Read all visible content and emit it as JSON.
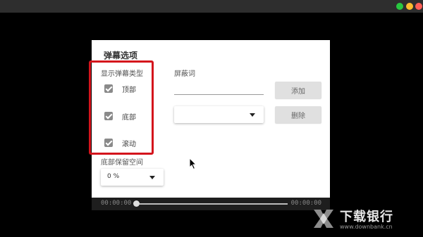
{
  "window": {
    "controls": [
      "close",
      "minimize",
      "zoom"
    ]
  },
  "panel": {
    "title": "弹幕选项",
    "danmaku_type": {
      "label": "显示弹幕类型",
      "options": [
        {
          "label": "顶部",
          "checked": true
        },
        {
          "label": "底部",
          "checked": true
        },
        {
          "label": "滚动",
          "checked": true
        }
      ]
    },
    "block_words": {
      "label": "屏蔽词",
      "input_value": "",
      "add_button": "添加",
      "delete_button": "删除",
      "list_value": ""
    },
    "bottom_reserve": {
      "label": "底部保留空间",
      "value": "0 %"
    }
  },
  "player": {
    "current_time": "00:00:00",
    "total_time": "00:00:00",
    "progress": 0
  },
  "watermark": {
    "name": "下载银行",
    "url": "www.downbank.cn"
  },
  "colors": {
    "highlight_border": "#d4141c",
    "checkbox": "#8a8a8a",
    "button_bg": "#e0e0e0"
  }
}
